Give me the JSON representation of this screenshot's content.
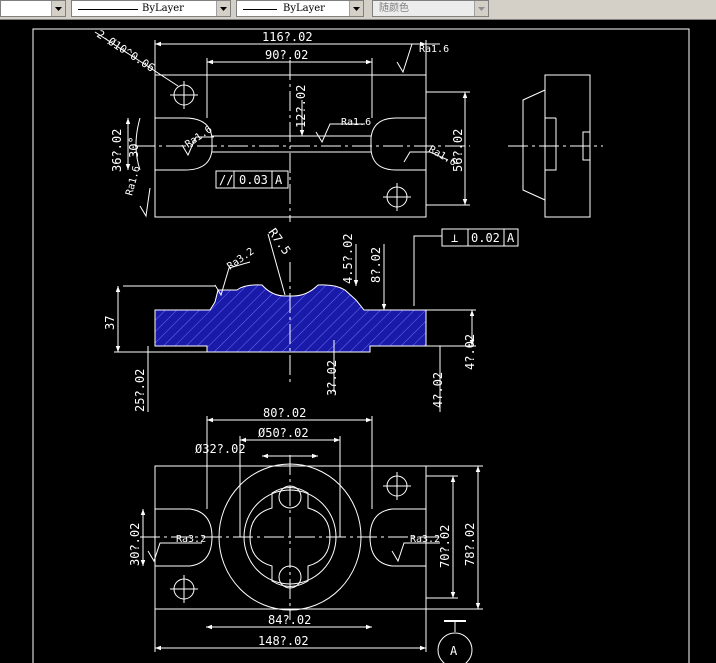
{
  "toolbar": {
    "linetype_label": "ByLayer",
    "lineweight_label": "ByLayer",
    "plotstyle_label": "随颜色"
  },
  "drawing": {
    "top_view": {
      "dim_overall_width": "116?.02",
      "dim_inner_width": "90?.02",
      "dim_slot_width": "12?.02",
      "dim_left_height": "36?.02",
      "dim_right_height": "56?.02",
      "dim_angle": "30°",
      "hole_callout": "2-Ø10^0.06",
      "roughness_1": "Ra1.6",
      "roughness_2": "Ra1.6",
      "roughness_3": "Ra1.6",
      "roughness_4": "Ra1.6",
      "roughness_5": "Ra1.6",
      "tol_symbol": "//",
      "tol_value": "0.03",
      "tol_datum": "A"
    },
    "section_view": {
      "dim_radius": "R7.5",
      "dim_depth": "4.5?.02",
      "dim_height_8": "8?.02",
      "dim_37": "37",
      "dim_25": "25?.02",
      "dim_3": "3?.02",
      "dim_4_right": "4?.02",
      "dim_4_bottom": "4?.02",
      "roughness": "Ra3.2",
      "tol_symbol": "⊥",
      "tol_value": "0.02",
      "tol_datum": "A"
    },
    "bottom_view": {
      "dim_80": "80?.02",
      "dim_dia50": "Ø50?.02",
      "dim_dia32": "Ø32?.02",
      "dim_30": "30?.02",
      "dim_70": "70?.02",
      "dim_78": "78?.02",
      "dim_84": "84?.02",
      "dim_148": "148?.02",
      "roughness_left": "Ra3.2",
      "roughness_right": "Ra3.2",
      "datum_label": "A"
    }
  },
  "colors": {
    "background": "#000000",
    "lines": "#ffffff",
    "hatch": "#1a1aa8"
  }
}
